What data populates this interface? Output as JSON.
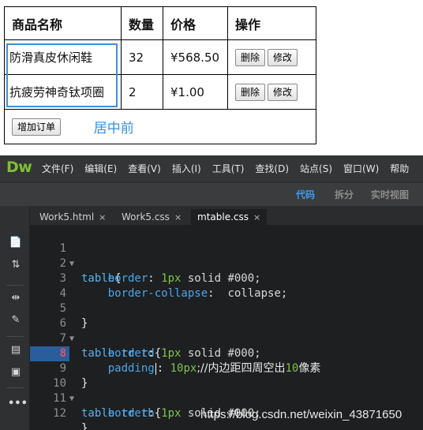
{
  "preview": {
    "headers": [
      "商品名称",
      "数量",
      "价格",
      "操作"
    ],
    "rows": [
      {
        "name": "防滑真皮休闲鞋",
        "qty": "32",
        "price": "¥568.50",
        "delete_label": "删除",
        "edit_label": "修改"
      },
      {
        "name": "抗疲劳神奇钛项圈",
        "qty": "2",
        "price": "¥1.00",
        "delete_label": "删除",
        "edit_label": "修改"
      }
    ],
    "add_order_label": "增加订单",
    "center_text": "居中前",
    "accent_color": "#3d8fdc"
  },
  "dreamweaver": {
    "logo": "Dw",
    "menus": [
      "文件(F)",
      "编辑(E)",
      "查看(V)",
      "插入(I)",
      "工具(T)",
      "查找(D)",
      "站点(S)",
      "窗口(W)",
      "帮助"
    ],
    "views": {
      "code": "代码",
      "split": "拆分",
      "live": "实时视图"
    },
    "tabs": [
      {
        "label": "Work5.html",
        "close": "×"
      },
      {
        "label": "Work5.css",
        "close": "×"
      },
      {
        "label": "mtable.css",
        "close": "×"
      }
    ],
    "tools": [
      "file-icon",
      "sort-icon",
      "expand-icon",
      "wand-icon",
      "comment-icon",
      "snippet-icon",
      "more-icon"
    ],
    "line_numbers": [
      "1",
      "2",
      "3",
      "4",
      "5",
      "6",
      "7",
      "8",
      "9",
      "10",
      "11",
      "12"
    ],
    "code": {
      "l1_sel": "table",
      "l1_brace": "{",
      "l2_prop": "border",
      "l2_num": "1px",
      "l2_val": " solid #000;",
      "l3_prop": "border-collapse",
      "l3_val": " collapse;",
      "l5_brace": "}",
      "l6_sel": "table tr td",
      "l6_brace": "{",
      "l7_prop": "border",
      "l7_num": "1px",
      "l7_val": " solid #000;",
      "l8_prop": "padding",
      "l8_num": "10px",
      "l8_comment_a": ";//内边距四周空出",
      "l8_comment_num": "10",
      "l8_comment_b": "像素",
      "l9_brace": "}",
      "l10_sel": "table tr th",
      "l10_brace": "{",
      "l11_prop": "border",
      "l11_num": "1px",
      "l11_val": " solid #000;",
      "l12_brace": "}"
    },
    "error_line": "8"
  },
  "watermark": "https://blog.csdn.net/weixin_43871650"
}
